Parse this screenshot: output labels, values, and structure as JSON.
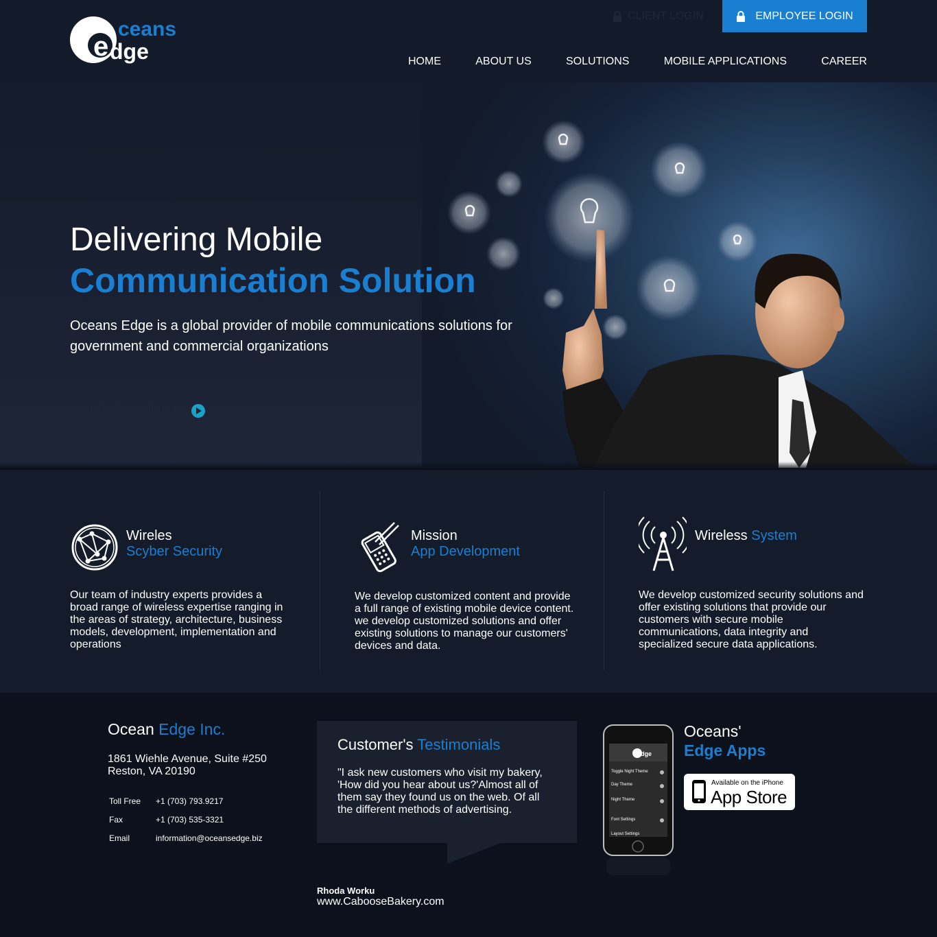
{
  "brand": {
    "logo_text_top": "ceans",
    "logo_text_bottom": "dge",
    "logo_letter": "e"
  },
  "header": {
    "client_login": "CLIENT LOGIN",
    "employee_login": "EMPLOYEE LOGIN",
    "nav": [
      "HOME",
      "ABOUT US",
      "SOLUTIONS",
      "MOBILE APPLICATIONS",
      "CAREER"
    ]
  },
  "hero": {
    "title_line1": "Delivering Mobile",
    "title_line2": "Communication Solution",
    "description": "Oceans Edge is a global provider of mobile communications solutions for government and commercial organizations",
    "learn_more": "LEARN MORE"
  },
  "features": [
    {
      "title_white": "Wireles",
      "title_blue": "Scyber Security",
      "icon": "globe-network-icon",
      "description": "Our team of industry experts provides a broad range of wireless expertise ranging in the areas of strategy, architecture, business models, development, implementation and operations"
    },
    {
      "title_white": "Mission",
      "title_blue": "App Development",
      "icon": "mobile-phone-icon",
      "description": "We develop customized content and provide a full range of existing mobile device content. we develop customized solutions and offer existing solutions to manage our customers' devices and data."
    },
    {
      "title_white": "Wireless",
      "title_blue": "System",
      "icon": "radio-tower-icon",
      "description": "We develop customized security solutions and offer existing solutions that provide our customers with secure mobile communications, data integrity and specialized secure data applications."
    }
  ],
  "footer": {
    "company_white": "Ocean",
    "company_blue": "Edge Inc.",
    "address_line1": "1861 Wiehle Avenue, Suite #250",
    "address_line2": "Reston, VA 20190",
    "contacts": [
      {
        "label": "Toll Free",
        "value": "+1 (703) 793.9217"
      },
      {
        "label": "Fax",
        "value": "+1 (703) 535-3321"
      },
      {
        "label": "Email",
        "value": "information@oceansedge.biz"
      }
    ],
    "testimonial_title_white": "Customer's",
    "testimonial_title_blue": "Testimonials",
    "testimonial_quote": "\"I ask new customers who visit my bakery, 'How did you hear about us?'Almost all of them say they found us on the web. Of all the different methods of advertising.",
    "author_name": "Rhoda Worku",
    "author_site": "www.CabooseBakery.com",
    "apps_title_line1": "Oceans'",
    "apps_title_line2": "Edge Apps",
    "appstore_small": "Available on the iPhone",
    "appstore_big": "App Store",
    "phone_screen_items": [
      "Toggle Night Theme",
      "Day Theme",
      "Night Theme",
      "Font Settings",
      "Layout Settings"
    ]
  },
  "colors": {
    "accent": "#1a7fd1",
    "background": "#141b2a",
    "footer": "#0c111b"
  }
}
